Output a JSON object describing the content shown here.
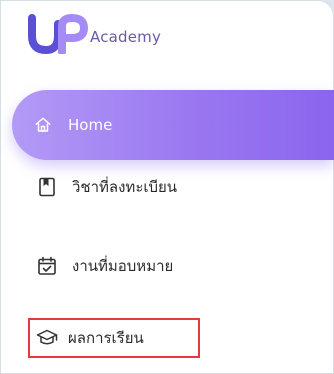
{
  "brand": {
    "name": "Academy",
    "logo_colors": [
      "#5b4fd6",
      "#a48bf5",
      "#6a5aa8"
    ]
  },
  "nav": {
    "items": [
      {
        "label": "Home",
        "icon": "home-icon",
        "active": true
      },
      {
        "label": "วิชาที่ลงทะเบียน",
        "icon": "book-icon",
        "active": false
      },
      {
        "label": "งานที่มอบหมาย",
        "icon": "calendar-icon",
        "active": false
      },
      {
        "label": "ผลการเรียน",
        "icon": "graduation-cap-icon",
        "active": false,
        "highlighted": true
      }
    ]
  },
  "colors": {
    "active_gradient_start": "#b39af6",
    "active_gradient_end": "#8a65ee",
    "highlight_border": "#e33b3b"
  }
}
